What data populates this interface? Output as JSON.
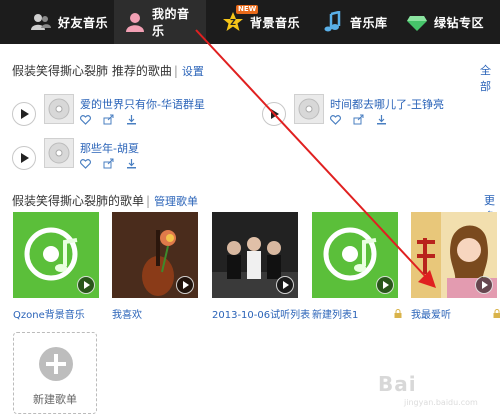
{
  "nav": {
    "items": [
      {
        "label": "好友音乐",
        "icon": "friends-icon"
      },
      {
        "label": "我的音乐",
        "icon": "user-icon",
        "active": true
      },
      {
        "label": "背景音乐",
        "icon": "star-icon",
        "badge": "NEW"
      },
      {
        "label": "音乐库",
        "icon": "music-note-icon"
      },
      {
        "label": "绿钻专区",
        "icon": "diamond-icon"
      }
    ]
  },
  "recommended": {
    "title": "假装笑得撕心裂肺 推荐的歌曲",
    "settings_link": "设置",
    "all_link": "全部",
    "songs": [
      {
        "title": "爱的世界只有你-华语群星"
      },
      {
        "title": "时间都去哪儿了-王铮亮"
      },
      {
        "title": "那些年-胡夏"
      }
    ]
  },
  "playlists": {
    "title": "假装笑得撕心裂肺的歌单",
    "manage_link": "管理歌单",
    "more_link": "更多",
    "items": [
      {
        "name": "Qzone背景音乐"
      },
      {
        "name": "我喜欢"
      },
      {
        "name": "2013-10-06试听列表"
      },
      {
        "name": "新建列表1"
      },
      {
        "name": "我最爱听"
      }
    ],
    "new_label": "新建歌单"
  },
  "watermark": {
    "text": "Bai",
    "sub": "jingyan.baidu.com"
  },
  "colors": {
    "nav_bg": "#1c1c1c",
    "link": "#2a63b8",
    "arrow": "#e02020",
    "green_cover": "#5bbf3a"
  }
}
